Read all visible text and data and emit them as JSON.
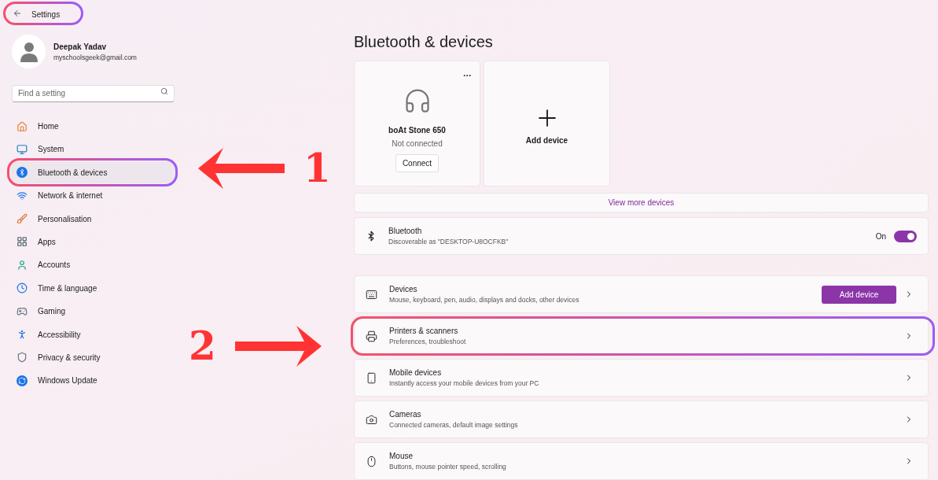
{
  "title_bar": {
    "title": "Settings",
    "highlighted": true
  },
  "user": {
    "name": "Deepak Yadav",
    "email": "myschoolsgeek@gmail.com"
  },
  "search": {
    "placeholder": "Find a setting"
  },
  "nav": [
    {
      "label": "Home",
      "selected": false,
      "highlighted": false
    },
    {
      "label": "System",
      "selected": false,
      "highlighted": false
    },
    {
      "label": "Bluetooth & devices",
      "selected": true,
      "highlighted": true
    },
    {
      "label": "Network & internet",
      "selected": false,
      "highlighted": false
    },
    {
      "label": "Personalisation",
      "selected": false,
      "highlighted": false
    },
    {
      "label": "Apps",
      "selected": false,
      "highlighted": false
    },
    {
      "label": "Accounts",
      "selected": false,
      "highlighted": false
    },
    {
      "label": "Time & language",
      "selected": false,
      "highlighted": false
    },
    {
      "label": "Gaming",
      "selected": false,
      "highlighted": false
    },
    {
      "label": "Accessibility",
      "selected": false,
      "highlighted": false
    },
    {
      "label": "Privacy & security",
      "selected": false,
      "highlighted": false
    },
    {
      "label": "Windows Update",
      "selected": false,
      "highlighted": false
    }
  ],
  "page_title": "Bluetooth & devices",
  "device_cards": [
    {
      "kind": "device",
      "name": "boAt Stone 650",
      "status": "Not connected",
      "button": "Connect"
    },
    {
      "kind": "add",
      "label": "Add device"
    }
  ],
  "view_more": "View more devices",
  "bluetooth": {
    "title": "Bluetooth",
    "subtitle": "Discoverable as \"DESKTOP-U8OCFKB\"",
    "state_label": "On",
    "on": true
  },
  "rows": [
    {
      "title": "Devices",
      "subtitle": "Mouse, keyboard, pen, audio, displays and docks, other devices",
      "button": "Add device",
      "highlighted": false
    },
    {
      "title": "Printers & scanners",
      "subtitle": "Preferences, troubleshoot",
      "highlighted": true
    },
    {
      "title": "Mobile devices",
      "subtitle": "Instantly access your mobile devices from your PC",
      "highlighted": false
    },
    {
      "title": "Cameras",
      "subtitle": "Connected cameras, default image settings",
      "highlighted": false
    },
    {
      "title": "Mouse",
      "subtitle": "Buttons, mouse pointer speed, scrolling",
      "highlighted": false
    }
  ],
  "annotations": [
    {
      "label": "1",
      "kind": "left"
    },
    {
      "label": "2",
      "kind": "right"
    }
  ]
}
